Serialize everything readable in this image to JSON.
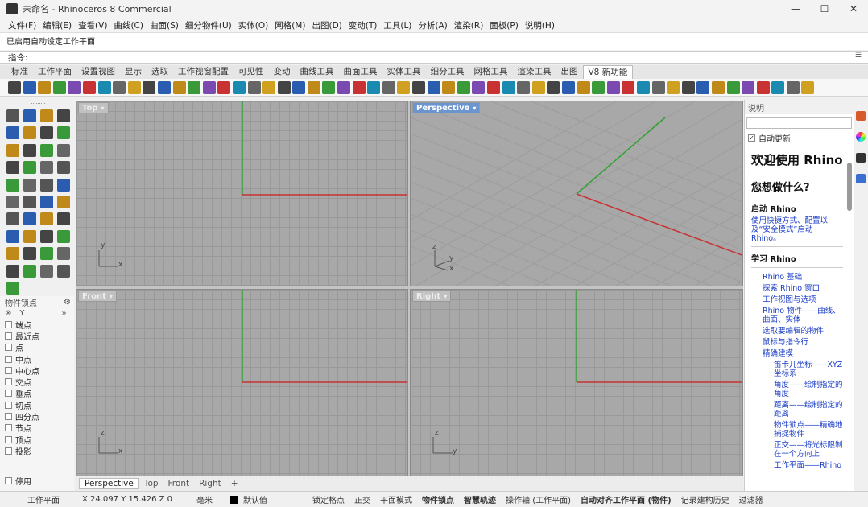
{
  "window": {
    "title": "未命名 - Rhinoceros 8 Commercial",
    "controls": [
      "—",
      "☐",
      "✕"
    ]
  },
  "menu": [
    "文件(F)",
    "编辑(E)",
    "查看(V)",
    "曲线(C)",
    "曲面(S)",
    "细分物件(U)",
    "实体(O)",
    "网格(M)",
    "出图(D)",
    "变动(T)",
    "工具(L)",
    "分析(A)",
    "渲染(R)",
    "面板(P)",
    "说明(H)"
  ],
  "command_history": "已启用自动设定工作平面",
  "command_prompt": "指令:",
  "ribbon_tabs": [
    "标准",
    "工作平面",
    "设置视图",
    "显示",
    "选取",
    "工作视窗配置",
    "可见性",
    "变动",
    "曲线工具",
    "曲面工具",
    "实体工具",
    "细分工具",
    "网格工具",
    "渲染工具",
    "出图",
    "V8 新功能"
  ],
  "active_ribbon_tab": "V8 新功能",
  "viewports": {
    "top": {
      "label": "Top",
      "axis1": "y",
      "axis2": "x"
    },
    "perspective": {
      "label": "Perspective",
      "axis1": "z",
      "axis2": "y",
      "axis3": "x"
    },
    "front": {
      "label": "Front",
      "axis1": "z",
      "axis2": "x"
    },
    "right": {
      "label": "Right",
      "axis1": "z",
      "axis2": "y"
    }
  },
  "view_tabs": [
    "Perspective",
    "Top",
    "Front",
    "Right"
  ],
  "view_tabs_add": "+",
  "osnap": {
    "title": "物件锁点",
    "items": [
      "端点",
      "最近点",
      "点",
      "中点",
      "中心点",
      "交点",
      "垂点",
      "切点",
      "四分点",
      "节点",
      "顶点",
      "投影"
    ],
    "disable": "停用",
    "expand": "»"
  },
  "help": {
    "title": "说明",
    "autoupdate": "自动更新",
    "welcome": "欢迎使用 Rhino",
    "question": "您想做什么?",
    "start_heading": "启动 Rhino",
    "start_link": "使用快捷方式、配置以及“安全模式”启动 Rhino。",
    "learn_heading": "学习 Rhino",
    "links": [
      {
        "text": "Rhino 基础",
        "level": 1
      },
      {
        "text": "探索 Rhino 窗口",
        "level": 1
      },
      {
        "text": "工作视图与选项",
        "level": 1
      },
      {
        "text": "Rhino 物件——曲线、曲面、实体",
        "level": 1
      },
      {
        "text": "选取要编辑的物件",
        "level": 1
      },
      {
        "text": "鼠标与指令行",
        "level": 1
      },
      {
        "text": "精确建模",
        "level": 1
      },
      {
        "text": "笛卡儿坐标——XYZ坐标系",
        "level": 2
      },
      {
        "text": "角度——绘制指定的角度",
        "level": 2
      },
      {
        "text": "距离——绘制指定的距离",
        "level": 2
      },
      {
        "text": "物件锁点——精确地捕捉物件",
        "level": 2
      },
      {
        "text": "正交——将光标限制在一个方向上",
        "level": 2
      },
      {
        "text": "工作平面——Rhino",
        "level": 2
      }
    ]
  },
  "status": {
    "cplane": "工作平面",
    "coords": "X 24.097 Y 15.426 Z 0",
    "units": "毫米",
    "layer": "默认值",
    "items": [
      "锁定格点",
      "正交",
      "平面模式",
      "物件锁点",
      "智慧轨迹",
      "操作轴 (工作平面)",
      "自动对齐工作平面 (物件)",
      "记录建构历史",
      "过滤器"
    ],
    "bold_flags": [
      false,
      false,
      false,
      true,
      true,
      false,
      true,
      false,
      false
    ]
  },
  "colors": {
    "viewport_bg": "#a8a8a8",
    "grid_line": "#999999",
    "axis_x": "#c83232",
    "axis_y": "#32a032",
    "active_label": "#6b95d1",
    "link": "#1a3cc6"
  }
}
